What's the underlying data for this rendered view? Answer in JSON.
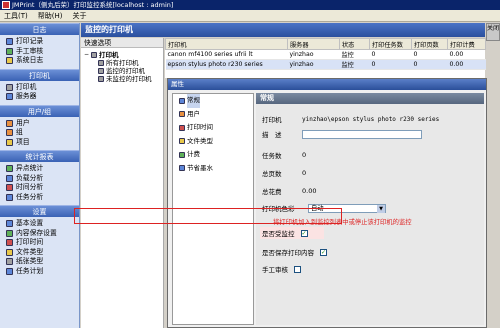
{
  "window": {
    "title": "JMPrint（侧丸后荣）打印监控系统[localhost : admin]"
  },
  "menu": [
    "工具(T)",
    "帮助(H)",
    "关于"
  ],
  "sidebar": {
    "sections": [
      {
        "title": "日志",
        "items": [
          {
            "label": "打印记录",
            "icon": "print-log-icon"
          },
          {
            "label": "手工审核",
            "icon": "manual-review-icon"
          },
          {
            "label": "系统日志",
            "icon": "system-log-icon"
          }
        ]
      },
      {
        "title": "打印机",
        "items": [
          {
            "label": "打印机",
            "icon": "printer-icon"
          },
          {
            "label": "服务器",
            "icon": "server-icon"
          }
        ]
      },
      {
        "title": "用户/组",
        "items": [
          {
            "label": "用户",
            "icon": "user-icon"
          },
          {
            "label": "组",
            "icon": "group-icon"
          },
          {
            "label": "项目",
            "icon": "project-icon"
          }
        ]
      },
      {
        "title": "统计报表",
        "items": [
          {
            "label": "异点统计",
            "icon": "stats-icon"
          },
          {
            "label": "负载分析",
            "icon": "load-analysis-icon"
          },
          {
            "label": "时间分析",
            "icon": "time-analysis-icon"
          },
          {
            "label": "任务分析",
            "icon": "task-analysis-icon"
          }
        ]
      },
      {
        "title": "设置",
        "items": [
          {
            "label": "基本设置",
            "icon": "basic-settings-icon"
          },
          {
            "label": "内容保存设置",
            "icon": "content-save-icon"
          },
          {
            "label": "打印时间",
            "icon": "print-time-icon"
          },
          {
            "label": "文件类型",
            "icon": "file-type-icon"
          },
          {
            "label": "纸张类型",
            "icon": "paper-type-icon"
          },
          {
            "label": "任务计划",
            "icon": "task-schedule-icon"
          }
        ]
      }
    ]
  },
  "main": {
    "title": "监控的打印机",
    "close_label": "关闭"
  },
  "tree": {
    "title": "快速选项",
    "root": "打印机",
    "children": [
      "所有打印机",
      "监控的打印机",
      "未监控的打印机"
    ]
  },
  "grid": {
    "columns": [
      "打印机",
      "服务器",
      "状态",
      "打印任务数",
      "打印页数",
      "打印计费"
    ],
    "rows": [
      [
        "canon mf4100 series ufrii lt",
        "yinzhao",
        "监控",
        "0",
        "0",
        "0.00"
      ],
      [
        "epson stylus photo r230 series",
        "yinzhao",
        "监控",
        "0",
        "0",
        "0.00"
      ]
    ]
  },
  "dialog": {
    "title": "属性",
    "nav": [
      {
        "label": "常规",
        "icon": "general-icon"
      },
      {
        "label": "用户",
        "icon": "user-icon"
      },
      {
        "label": "打印时间",
        "icon": "print-time-icon"
      },
      {
        "label": "文件类型",
        "icon": "file-type-icon"
      },
      {
        "label": "计费",
        "icon": "billing-icon"
      },
      {
        "label": "节省墨水",
        "icon": "save-ink-icon"
      }
    ],
    "panel_title": "常规",
    "fields": {
      "printer_label": "打印机",
      "printer_value": "yinzhao\\epson stylus photo r230 series",
      "desc_label": "描　述",
      "task_count_label": "任务数",
      "task_count_value": "0",
      "pages_label": "总页数",
      "pages_value": "0",
      "cost_label": "总花费",
      "cost_value": "0.00",
      "color_label": "打印机色彩",
      "color_value": "自动",
      "monitored_label": "是否受监控",
      "save_content_label": "是否保存打印内容",
      "manual_review_label": "手工审核"
    },
    "annotation": "将打印机加入到监控列表中或停止该打印机的监控"
  }
}
